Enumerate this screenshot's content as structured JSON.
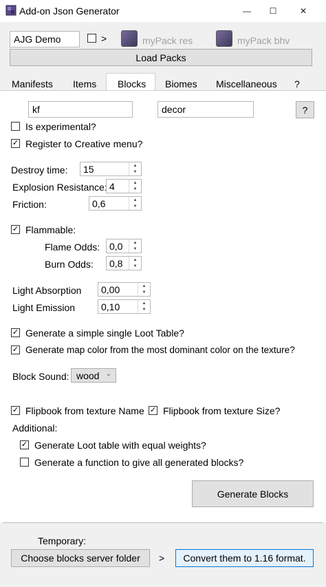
{
  "window": {
    "title": "Add-on Json Generator",
    "minimize": "—",
    "maximize": "☐",
    "close": "✕"
  },
  "top": {
    "project_name": "AJG Demo",
    "arrow": ">",
    "res_pack": "myPack res",
    "bhv_pack": "myPack bhv",
    "load_button": "Load Packs"
  },
  "tabs": [
    {
      "label": "Manifests"
    },
    {
      "label": "Items"
    },
    {
      "label": "Blocks",
      "active": true
    },
    {
      "label": "Biomes"
    },
    {
      "label": "Miscellaneous"
    },
    {
      "label": "?"
    }
  ],
  "blocks": {
    "namespace": "kf",
    "category": "decor",
    "help": "?",
    "is_experimental": {
      "label": "Is experimental?",
      "checked": false
    },
    "register_creative": {
      "label": "Register to Creative menu?",
      "checked": true
    },
    "destroy_time": {
      "label": "Destroy time:",
      "value": "15"
    },
    "explosion_resistance": {
      "label": "Explosion Resistance:",
      "value": "4"
    },
    "friction": {
      "label": "Friction:",
      "value": "0,6"
    },
    "flammable": {
      "label": "Flammable:",
      "checked": true
    },
    "flame_odds": {
      "label": "Flame Odds:",
      "value": "0,0"
    },
    "burn_odds": {
      "label": "Burn Odds:",
      "value": "0,8"
    },
    "light_absorption": {
      "label": "Light Absorption",
      "value": "0,00"
    },
    "light_emission": {
      "label": "Light Emission",
      "value": "0,10"
    },
    "loot_table": {
      "label": "Generate a simple single Loot Table?",
      "checked": true
    },
    "map_color": {
      "label": "Generate map color from the most dominant color on the texture?",
      "checked": true
    },
    "block_sound": {
      "label": "Block Sound:",
      "value": "wood"
    },
    "flipbook_name": {
      "label": "Flipbook from texture Name",
      "checked": true
    },
    "flipbook_size": {
      "label": "Flipbook from texture Size?",
      "checked": true
    },
    "additional_label": "Additional:",
    "equal_weights": {
      "label": "Generate Loot table with equal weights?",
      "checked": true
    },
    "give_function": {
      "label": "Generate a function to give all generated blocks?",
      "checked": false
    },
    "generate_button": "Generate Blocks"
  },
  "temporary": {
    "label": "Temporary:",
    "choose_button": "Choose blocks server folder",
    "arrow": ">",
    "convert_button": "Convert them to 1.16 format."
  },
  "colors": {
    "accent_button_bg": "#e5f1fb",
    "accent_button_border": "#0078d7"
  }
}
